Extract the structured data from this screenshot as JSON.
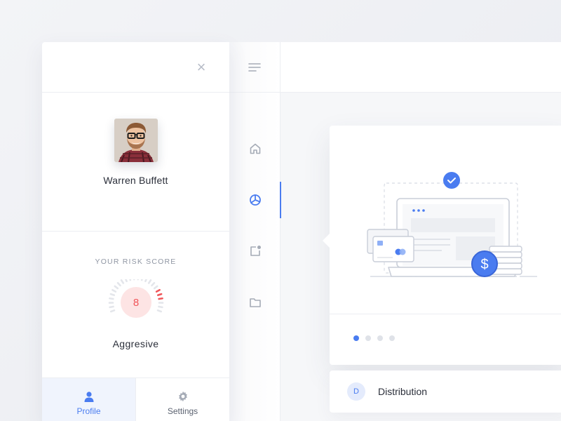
{
  "profile": {
    "name": "Warren Buffett",
    "close_symbol": "×",
    "risk": {
      "title": "YOUR RISK SCORE",
      "score": "8",
      "score_max": 10,
      "level": "Aggresive"
    },
    "tabs": [
      {
        "label": "Profile",
        "icon": "user-icon",
        "active": true
      },
      {
        "label": "Settings",
        "icon": "gear-icon",
        "active": false
      }
    ]
  },
  "rail": {
    "menu_icon": "menu-icon",
    "items": [
      {
        "icon": "home-icon",
        "active": false
      },
      {
        "icon": "pie-chart-icon",
        "active": true
      },
      {
        "icon": "notification-icon",
        "active": false
      },
      {
        "icon": "folder-icon",
        "active": false
      }
    ]
  },
  "card": {
    "illustration": "laptop-payment-illustration",
    "carousel": {
      "count": 4,
      "active_index": 0
    }
  },
  "list": {
    "items": [
      {
        "badge": "D",
        "label": "Distribution"
      }
    ]
  },
  "colors": {
    "accent": "#4a7cf0",
    "danger": "#f0565a",
    "danger_soft": "#fde4e4"
  }
}
